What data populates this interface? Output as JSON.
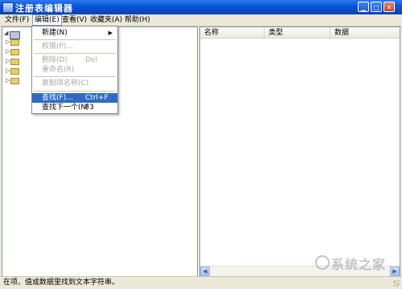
{
  "window": {
    "title": "注册表编辑器"
  },
  "menubar": [
    {
      "label": "文件(F)"
    },
    {
      "label": "编辑(E)"
    },
    {
      "label": "查看(V)"
    },
    {
      "label": "收藏夹(A)"
    },
    {
      "label": "帮助(H)"
    }
  ],
  "edit_menu": {
    "new": {
      "label": "新建(N)"
    },
    "permissions": {
      "label": "权限(P)..."
    },
    "delete": {
      "label": "删除(D)",
      "shortcut": "Del"
    },
    "rename": {
      "label": "重命名(R)"
    },
    "copy_key_name": {
      "label": "复制项名称(C)"
    },
    "find": {
      "label": "查找(F)...",
      "shortcut": "Ctrl+F"
    },
    "find_next": {
      "label": "查找下一个(N)",
      "shortcut": "F3"
    }
  },
  "list": {
    "columns": [
      "名称",
      "类型",
      "数据"
    ]
  },
  "status": {
    "text": "在项、值或数据里找到文本字符串。"
  },
  "watermark": {
    "text": "系统之家"
  }
}
